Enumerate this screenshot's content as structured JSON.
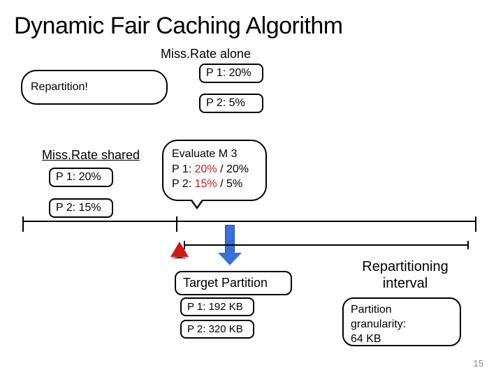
{
  "title": "Dynamic Fair Caching Algorithm",
  "miss_alone_label": "Miss.Rate alone",
  "repartition_label": "Repartition!",
  "alone": {
    "p1": "P 1: 20%",
    "p2": "P 2: 5%"
  },
  "miss_shared_label": "Miss.Rate shared",
  "shared": {
    "p1": "P 1: 20%",
    "p2": "P 2: 15%"
  },
  "evaluate": {
    "line1": "Evaluate M 3",
    "p1_prefix": "P 1: ",
    "p1_a": "20%",
    "p1_sep": " / ",
    "p1_b": "20%",
    "p2_prefix": "P 2: ",
    "p2_a": "15%",
    "p2_sep": " / ",
    "p2_b": "5%"
  },
  "target_label": "Target Partition",
  "target": {
    "p1": "P 1: 192 KB",
    "p2": "P 2: 320 KB"
  },
  "interval_label": "Repartitioning interval",
  "granularity": {
    "line1": "Partition",
    "line2": "granularity:",
    "line3": "64 KB"
  },
  "pagenum": "15"
}
